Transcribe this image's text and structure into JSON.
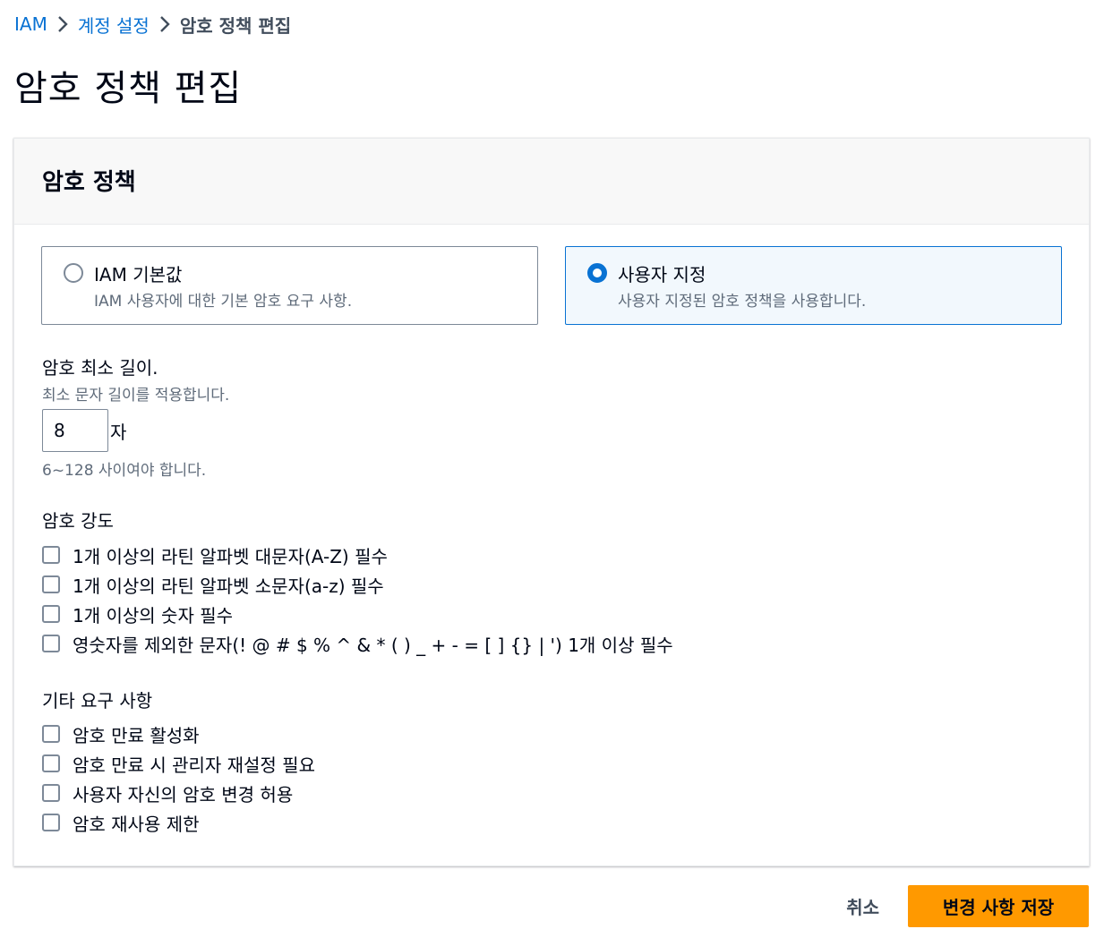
{
  "breadcrumb": {
    "items": [
      "IAM",
      "계정 설정",
      "암호 정책 편집"
    ]
  },
  "page": {
    "title": "암호 정책 편집"
  },
  "card": {
    "title": "암호 정책",
    "options": [
      {
        "label": "IAM 기본값",
        "description": "IAM 사용자에 대한 기본 암호 요구 사항.",
        "selected": false
      },
      {
        "label": "사용자 지정",
        "description": "사용자 지정된 암호 정책을 사용합니다.",
        "selected": true
      }
    ],
    "min_length": {
      "label": "암호 최소 길이.",
      "description": "최소 문자 길이를 적용합니다.",
      "value": "8",
      "unit": "자",
      "constraint": "6~128 사이여야 합니다."
    },
    "strength": {
      "label": "암호 강도",
      "items": [
        {
          "label": "1개 이상의 라틴 알파벳 대문자(A-Z) 필수",
          "checked": false
        },
        {
          "label": "1개 이상의 라틴 알파벳 소문자(a-z) 필수",
          "checked": false
        },
        {
          "label": "1개 이상의 숫자 필수",
          "checked": false
        },
        {
          "label": "영숫자를 제외한 문자(! @ # $ % ^ & * ( ) _ + - = [ ] {} | ') 1개 이상 필수",
          "checked": false
        }
      ]
    },
    "other": {
      "label": "기타 요구 사항",
      "items": [
        {
          "label": "암호 만료 활성화",
          "checked": false
        },
        {
          "label": "암호 만료 시 관리자 재설정 필요",
          "checked": false
        },
        {
          "label": "사용자 자신의 암호 변경 허용",
          "checked": false
        },
        {
          "label": "암호 재사용 제한",
          "checked": false
        }
      ]
    }
  },
  "actions": {
    "cancel_label": "취소",
    "save_label": "변경 사항 저장"
  },
  "colors": {
    "link": "#0972d3",
    "primary_button": "#ff9900",
    "selected_tile_bg": "#f2f8fd"
  }
}
